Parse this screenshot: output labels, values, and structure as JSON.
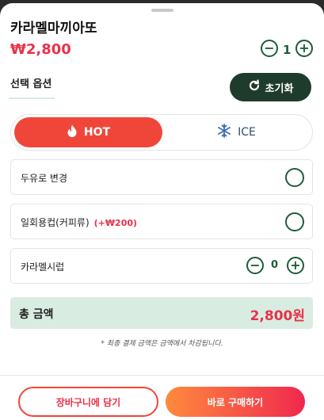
{
  "product": {
    "name": "카라멜마끼아또",
    "price": "₩2,800",
    "quantity": "1"
  },
  "options_tab": {
    "label": "선택 옵션",
    "reset_label": "초기화"
  },
  "temperature": {
    "hot_label": "HOT",
    "ice_label": "ICE",
    "selected": "HOT"
  },
  "options": [
    {
      "label": "두유로 변경",
      "extra": ""
    },
    {
      "label": "일회용컵(커피류)",
      "extra": "(+₩200)"
    },
    {
      "label": "카라멜시럽",
      "count": "0"
    }
  ],
  "total": {
    "label": "총 금액",
    "value": "2,800원"
  },
  "note": "* 최종 결제 금액은 금액에서 차감됩니다.",
  "actions": {
    "cart_label": "장바구니에 담기",
    "buy_label": "바로 구매하기"
  },
  "icons": {
    "hot": "fire-icon",
    "ice": "snowflake-icon",
    "reset": "refresh-icon"
  },
  "colors": {
    "brand_green": "#1e5c3a",
    "accent_red": "#e8324a",
    "hot_bg": "#f0463a",
    "total_bg": "#d9ece2"
  }
}
